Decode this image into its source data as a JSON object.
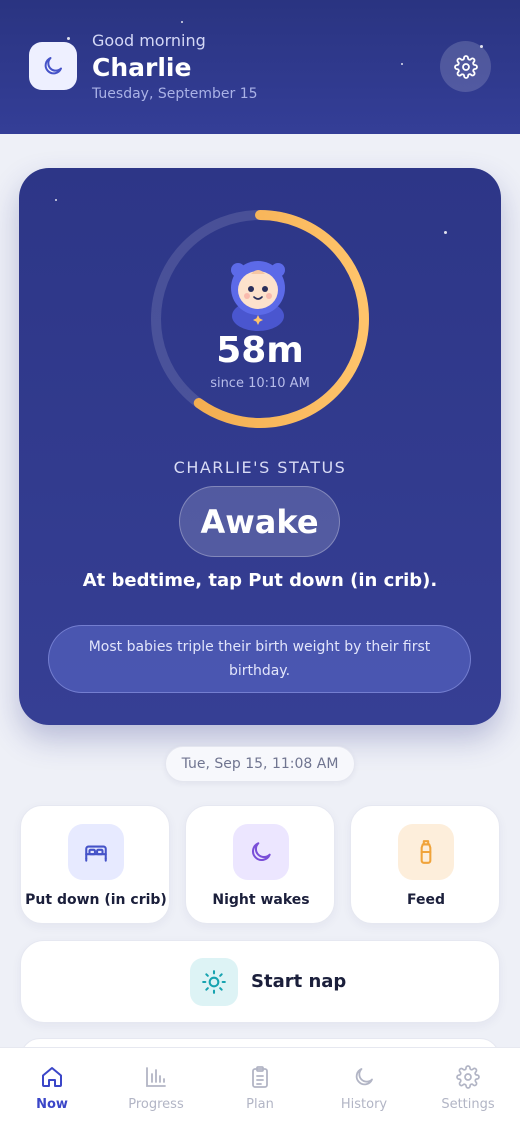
{
  "header": {
    "greeting": "Good morning",
    "name": "Charlie",
    "date": "Tuesday, September 15",
    "app_icon": "moon-icon",
    "settings_icon": "gear-icon"
  },
  "status_card": {
    "elapsed": "58m",
    "since": "since 10:10 AM",
    "progress_fraction": 0.6,
    "status_label": "CHARLIE'S STATUS",
    "status_value": "Awake",
    "instruction": "At bedtime, tap Put down (in crib).",
    "fact": "Most babies triple their birth weight by their first birthday."
  },
  "timestamp": "Tue, Sep 15, 11:08 AM",
  "actions": [
    {
      "label": "Put down (in crib)",
      "icon": "bed-icon",
      "color": "#4553c8"
    },
    {
      "label": "Night wakes",
      "icon": "moon-icon",
      "color": "#7a4fd8"
    },
    {
      "label": "Feed",
      "icon": "bottle-icon",
      "color": "#f0a33a"
    }
  ],
  "nap": {
    "label": "Start nap",
    "icon": "sun-icon",
    "color": "#17a3b0"
  },
  "bottom_nav": [
    {
      "label": "Now",
      "icon": "home-icon",
      "active": true
    },
    {
      "label": "Progress",
      "icon": "chart-icon",
      "active": false
    },
    {
      "label": "Plan",
      "icon": "clipboard-icon",
      "active": false
    },
    {
      "label": "History",
      "icon": "moon-icon",
      "active": false
    },
    {
      "label": "Settings",
      "icon": "gear-icon",
      "active": false
    }
  ],
  "colors": {
    "header_bg": "#2f3a8c",
    "card_bg": "#323b8e",
    "ring_gradient_start": "#ffc46b",
    "ring_gradient_end": "#f0a84a",
    "active_nav": "#3b46c8"
  }
}
